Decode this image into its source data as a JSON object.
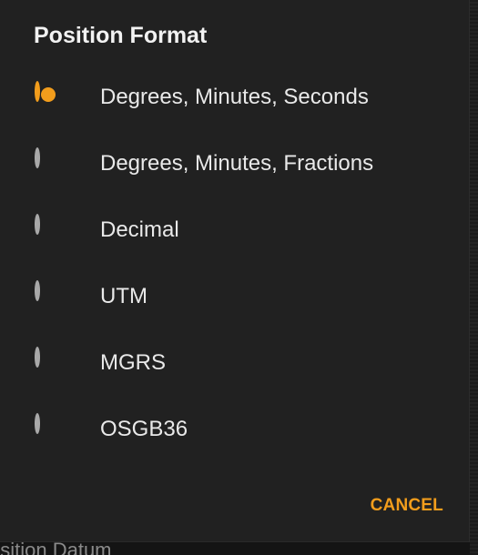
{
  "dialog": {
    "title": "Position Format",
    "selected_index": 0,
    "options": [
      {
        "label": "Degrees, Minutes, Seconds",
        "selected": true
      },
      {
        "label": "Degrees, Minutes, Fractions",
        "selected": false
      },
      {
        "label": "Decimal",
        "selected": false
      },
      {
        "label": "UTM",
        "selected": false
      },
      {
        "label": "MGRS",
        "selected": false
      },
      {
        "label": "OSGB36",
        "selected": false
      }
    ],
    "cancel_label": "CANCEL"
  },
  "background": {
    "partial_label": "osition Datum"
  },
  "colors": {
    "accent": "#f29d1c",
    "dialog_bg": "#212121",
    "text": "#e9e9e9",
    "radio_unselected": "#a9a9a9"
  },
  "icons": {
    "selected_option": "radio-selected-icon",
    "unselected_option": "radio-unselected-icon"
  }
}
